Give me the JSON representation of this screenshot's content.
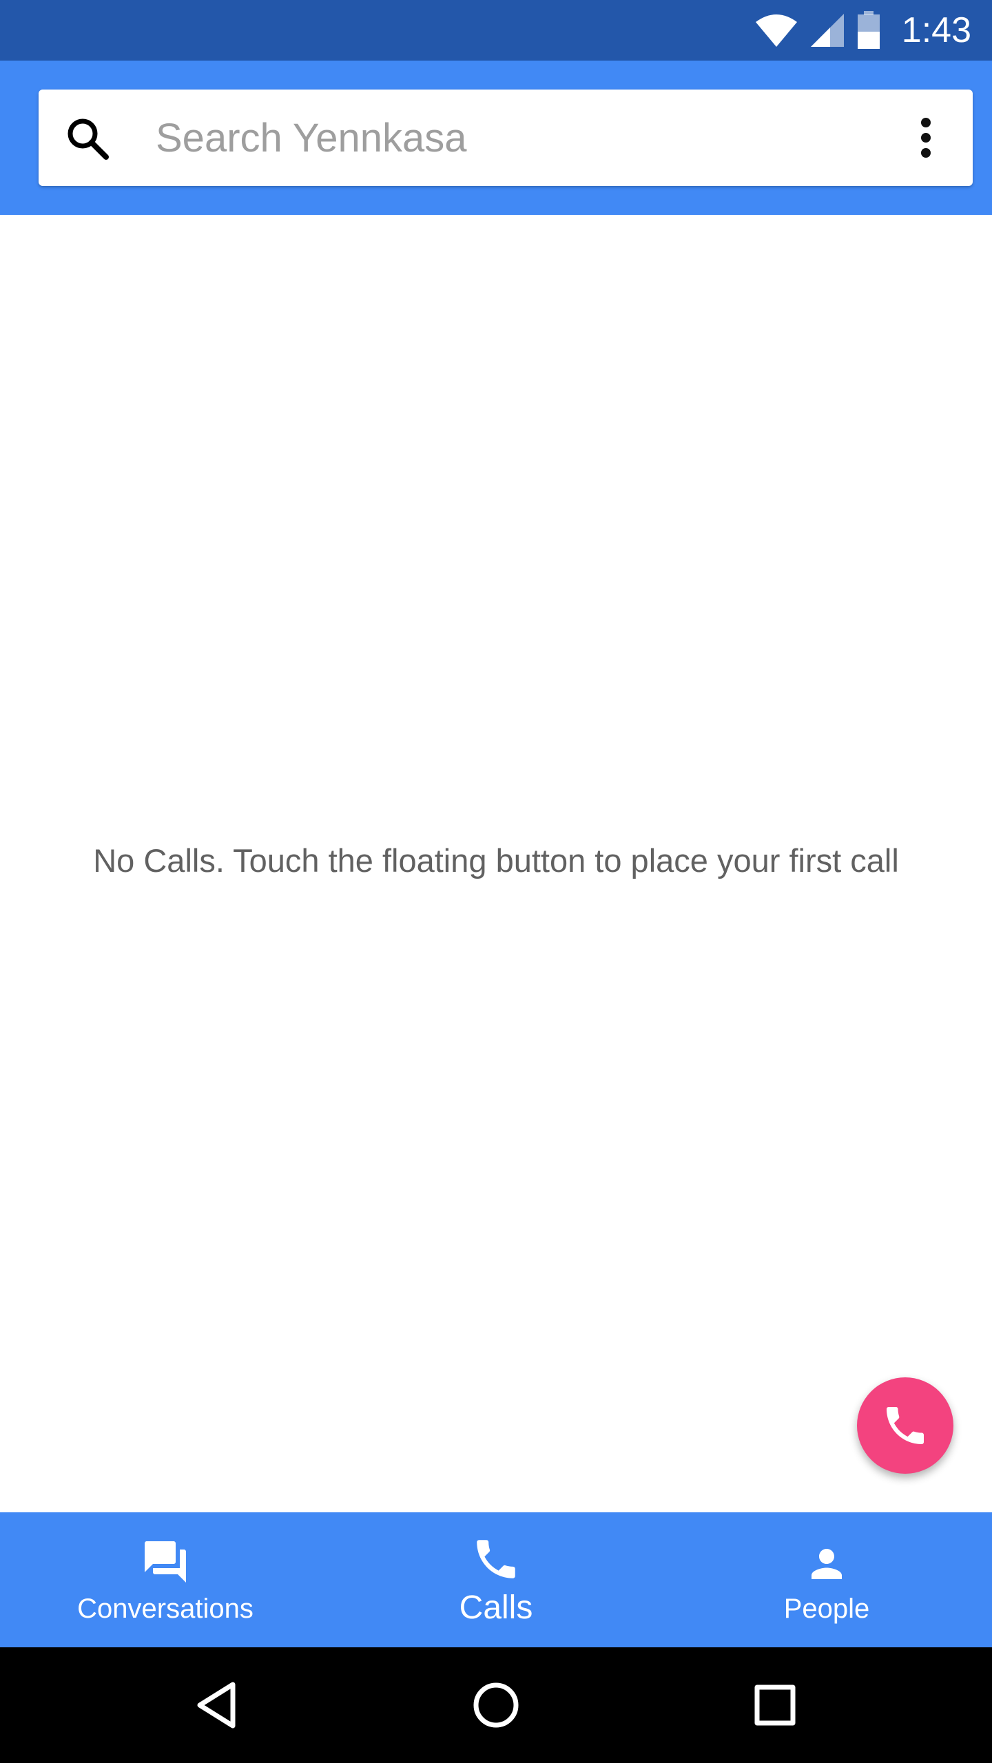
{
  "status_bar": {
    "time": "1:43",
    "icons": [
      "wifi-icon",
      "cellular-signal-icon",
      "battery-icon"
    ]
  },
  "search": {
    "placeholder": "Search Yennkasa",
    "value": "",
    "icon": "search-icon",
    "menu_icon": "more-vert-icon"
  },
  "main": {
    "empty_message": "No Calls. Touch the floating button to place your first call"
  },
  "fab": {
    "icon": "phone-icon"
  },
  "bottom_nav": {
    "items": [
      {
        "label": "Conversations",
        "icon": "forum-icon"
      },
      {
        "label": "Calls",
        "icon": "phone-icon",
        "selected": true
      },
      {
        "label": "People",
        "icon": "person-icon"
      }
    ]
  },
  "system_nav": {
    "buttons": [
      "back-icon",
      "home-icon",
      "recents-icon"
    ]
  },
  "colors": {
    "status_bar": "#2357aa",
    "primary": "#4189f5",
    "accent": "#f3437f",
    "empty_text": "#616161",
    "placeholder": "#9e9e9e"
  }
}
